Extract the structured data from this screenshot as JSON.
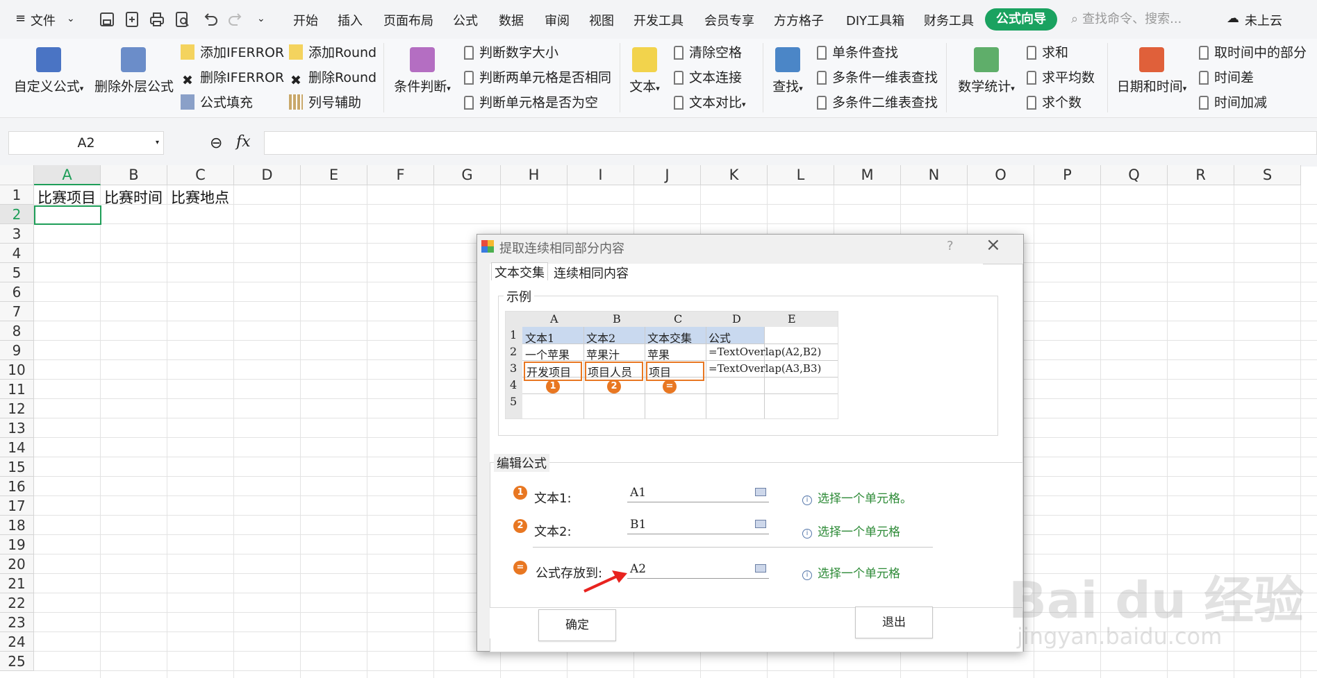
{
  "menubar": {
    "file": "文件",
    "tabs": [
      "开始",
      "插入",
      "页面布局",
      "公式",
      "数据",
      "审阅",
      "视图",
      "开发工具",
      "会员专享",
      "方方格子",
      "DIY工具箱",
      "财务工具"
    ],
    "active_tab": "公式向导",
    "search_placeholder": "查找命令、搜索...",
    "cloud": "未上云"
  },
  "ribbon": {
    "custom_formula": "自定义公式",
    "remove_outer": "删除外层公式",
    "add_iferror": "添加IFERROR",
    "del_iferror": "删除IFERROR",
    "formula_fill": "公式填充",
    "add_round": "添加Round",
    "del_round": "删除Round",
    "col_helper": "列号辅助",
    "condition": "条件判断",
    "judge_num": "判断数字大小",
    "judge_same": "判断两单元格是否相同",
    "judge_empty": "判断单元格是否为空",
    "text": "文本",
    "clear_space": "清除空格",
    "text_join": "文本连接",
    "text_compare": "文本对比",
    "lookup": "查找",
    "single_lookup": "单条件查找",
    "multi_1d": "多条件一维表查找",
    "multi_2d": "多条件二维表查找",
    "math": "数学统计",
    "sum": "求和",
    "avg": "求平均数",
    "count": "求个数",
    "datetime": "日期和时间",
    "time_part": "取时间中的部分",
    "time_diff": "时间差",
    "time_add": "时间加减"
  },
  "formula_bar": {
    "name_box": "A2",
    "fx": "fx"
  },
  "sheet": {
    "columns": [
      "A",
      "B",
      "C",
      "D",
      "E",
      "F",
      "G",
      "H",
      "I",
      "J",
      "K",
      "L",
      "M",
      "N",
      "O",
      "P",
      "Q",
      "R",
      "S"
    ],
    "rows": [
      "1",
      "2",
      "3",
      "4",
      "5",
      "6",
      "7",
      "8",
      "9",
      "10",
      "11",
      "12",
      "13",
      "14",
      "15",
      "16",
      "17",
      "18",
      "19",
      "20",
      "21",
      "22",
      "23",
      "24",
      "25"
    ],
    "cells": {
      "A1": "比赛项目",
      "B1": "比赛时间",
      "C1": "比赛地点"
    }
  },
  "dialog": {
    "title": "提取连续相同部分内容",
    "help": "?",
    "tab1": "文本交集",
    "tab2": "连续相同内容",
    "example_label": "示例",
    "example": {
      "cols": [
        "A",
        "B",
        "C",
        "D",
        "E"
      ],
      "rows": [
        "1",
        "2",
        "3",
        "4",
        "5"
      ],
      "r1": [
        "文本1",
        "文本2",
        "文本交集",
        "公式"
      ],
      "r2": [
        "一个苹果",
        "苹果汁",
        "苹果",
        "=TextOverlap(A2,B2)"
      ],
      "r3": [
        "开发项目",
        "项目人员",
        "项目",
        "=TextOverlap(A3,B3)"
      ],
      "markers": [
        "1",
        "2",
        "="
      ]
    },
    "edit_label": "编辑公式",
    "text1_label": "文本1:",
    "text1_value": "A1",
    "text1_hint": "选择一个单元格。",
    "text2_label": "文本2:",
    "text2_value": "B1",
    "text2_hint": "选择一个单元格",
    "store_label": "公式存放到:",
    "store_value": "A2",
    "store_hint": "选择一个单元格",
    "ok": "确定",
    "exit": "退出"
  },
  "watermark": {
    "brand": "Bai du 经验",
    "url": "jingyan.baidu.com"
  }
}
